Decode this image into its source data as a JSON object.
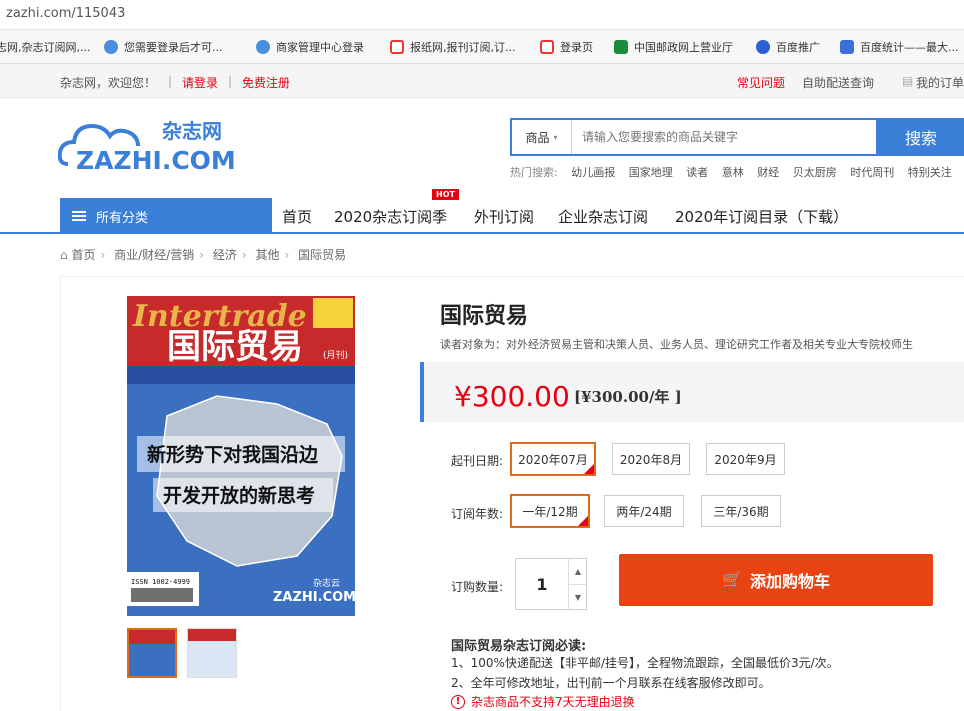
{
  "browser": {
    "url": "zazhi.com/115043",
    "bookmarks": [
      {
        "label": "志网,杂志订阅网,...",
        "icon": "zazhi-icon"
      },
      {
        "label": "您需要登录后才可...",
        "icon": "cloud-icon"
      },
      {
        "label": "商家管理中心登录",
        "icon": "cloud-icon"
      },
      {
        "label": "报纸网,报刊订阅,订...",
        "icon": "z-icon"
      },
      {
        "label": "登录页",
        "icon": "z-icon"
      },
      {
        "label": "中国邮政网上营业厅",
        "icon": "post-icon"
      },
      {
        "label": "百度推广",
        "icon": "paw-icon"
      },
      {
        "label": "百度统计——最大...",
        "icon": "chart-icon"
      }
    ]
  },
  "topnav": {
    "welcome": "杂志网，欢迎您！",
    "login": "请登录",
    "register": "免费注册",
    "faq": "常见问题",
    "delivery": "自助配送查询",
    "orders": "我的订单"
  },
  "header": {
    "logo_text": "ZAZHI.COM",
    "logo_cn": "杂志网",
    "search_category": "商品",
    "search_placeholder": "请输入您要搜索的商品关键字",
    "search_button": "搜索",
    "hot_label": "热门搜索:",
    "hot_keywords": [
      "幼儿画报",
      "国家地理",
      "读者",
      "意林",
      "财经",
      "贝太厨房",
      "时代周刊",
      "特别关注"
    ]
  },
  "nav": {
    "all_categories": "所有分类",
    "links": [
      "首页",
      "2020杂志订阅季",
      "外刊订阅",
      "企业杂志订阅",
      "2020年订阅目录（下载）"
    ],
    "hot_badge": "HOT"
  },
  "breadcrumb": [
    "首页",
    "商业/财经/营销",
    "经济",
    "其他",
    "国际贸易"
  ],
  "product": {
    "title": "国际贸易",
    "readers": "读者对象为：对外经济贸易主管和决策人员、业务人员、理论研究工作者及相关专业大专院校师生",
    "price": "¥300.00",
    "price_per_year": "[¥300.00/年 ]",
    "cover": {
      "masthead": "国际贸易",
      "en_masthead": "Intertrade",
      "issue": "(月刊)",
      "headline_1": "新形势下对我国沿边",
      "headline_2": "开发开放的新思考",
      "isbn": "ISSN 1002-4999",
      "brand": "ZAZHI.COM",
      "brand_cn": "杂志云"
    },
    "start_date_label": "起刊日期:",
    "start_dates": [
      "2020年07月",
      "2020年8月",
      "2020年9月"
    ],
    "start_selected": 0,
    "years_label": "订阅年数:",
    "years_options": [
      "一年/12期",
      "两年/24期",
      "三年/36期"
    ],
    "years_selected": 0,
    "qty_label": "订购数量:",
    "qty": "1",
    "add_to_cart": "添加购物车",
    "notice_title": "国际贸易杂志订阅必读:",
    "notices": [
      "1、100%快递配送【非平邮/挂号】，全程物流跟踪，全国最低价3元/次。",
      "2、全年可修改地址，出刊前一个月联系在线客服修改即可。"
    ],
    "warning": "杂志商品不支持7天无理由退换"
  },
  "colors": {
    "brand_blue": "#3a7fd8",
    "price_red": "#e60012",
    "cart_orange": "#e84411",
    "select_orange": "#e06a16"
  }
}
